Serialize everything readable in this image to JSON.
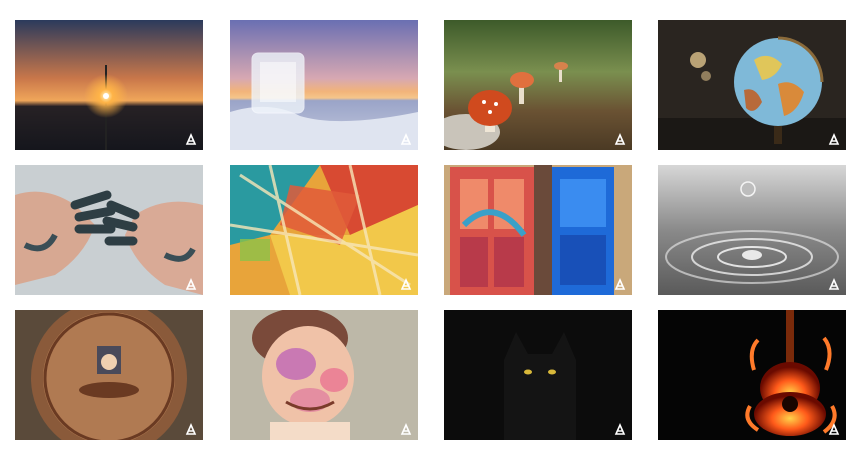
{
  "gallery": {
    "items": [
      {
        "name": "sparkler-sunset-photo",
        "icon": "watermark-logo-icon"
      },
      {
        "name": "ice-cube-sunset-photo",
        "icon": "watermark-logo-icon"
      },
      {
        "name": "mushrooms-forest-photo",
        "icon": "watermark-logo-icon"
      },
      {
        "name": "globe-photo",
        "icon": "watermark-logo-icon"
      },
      {
        "name": "painted-hands-photo",
        "icon": "watermark-logo-icon"
      },
      {
        "name": "abstract-paint-photo",
        "icon": "watermark-logo-icon"
      },
      {
        "name": "graffiti-doors-photo",
        "icon": "watermark-logo-icon"
      },
      {
        "name": "water-drop-photo",
        "icon": "watermark-logo-icon"
      },
      {
        "name": "clock-figure-photo",
        "icon": "watermark-logo-icon"
      },
      {
        "name": "painted-child-photo",
        "icon": "watermark-logo-icon"
      },
      {
        "name": "black-cat-photo",
        "icon": "watermark-logo-icon"
      },
      {
        "name": "fire-guitar-photo",
        "icon": "watermark-logo-icon"
      }
    ]
  }
}
